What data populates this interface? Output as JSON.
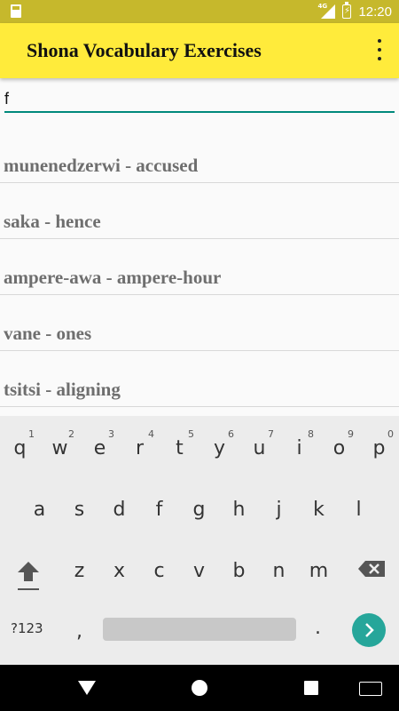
{
  "status_bar": {
    "network": "4G",
    "time": "12:20"
  },
  "app_bar": {
    "title": "Shona Vocabulary Exercises",
    "menu_icon": "more-vert-icon"
  },
  "search": {
    "value": "f"
  },
  "list": {
    "items": [
      "munenedzerwi - accused",
      "saka - hence",
      "ampere-awa - ampere-hour",
      "vane - ones",
      "tsitsi - aligning"
    ]
  },
  "keyboard": {
    "row1": [
      {
        "ch": "q",
        "hint": "1"
      },
      {
        "ch": "w",
        "hint": "2"
      },
      {
        "ch": "e",
        "hint": "3"
      },
      {
        "ch": "r",
        "hint": "4"
      },
      {
        "ch": "t",
        "hint": "5"
      },
      {
        "ch": "y",
        "hint": "6"
      },
      {
        "ch": "u",
        "hint": "7"
      },
      {
        "ch": "i",
        "hint": "8"
      },
      {
        "ch": "o",
        "hint": "9"
      },
      {
        "ch": "p",
        "hint": "0"
      }
    ],
    "row2": [
      "a",
      "s",
      "d",
      "f",
      "g",
      "h",
      "j",
      "k",
      "l"
    ],
    "row3": [
      "z",
      "x",
      "c",
      "v",
      "b",
      "n",
      "m"
    ],
    "num_label": "?123",
    "comma": ",",
    "period": "."
  },
  "colors": {
    "app_bar": "#ffeb3b",
    "status_bar": "#c6b82c",
    "accent": "#00897b",
    "enter": "#26a69a"
  }
}
